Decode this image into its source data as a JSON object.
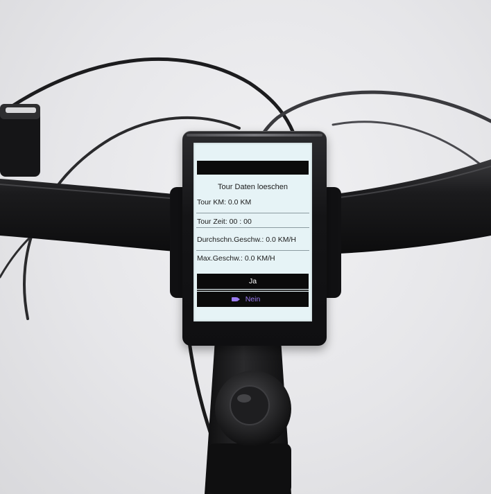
{
  "display": {
    "title": "Tour Daten loeschen",
    "rows": [
      "Tour KM: 0.0 KM",
      "Tour Zeit: 00 : 00",
      "Durchschn.Geschw.: 0.0 KM/H",
      "Max.Geschw.: 0.0 KM/H"
    ],
    "options": {
      "yes": "Ja",
      "no": "Nein"
    },
    "selected": "no"
  },
  "colors": {
    "screen_background": "#e6f3f6",
    "selection_accent": "#9b7bf0"
  }
}
